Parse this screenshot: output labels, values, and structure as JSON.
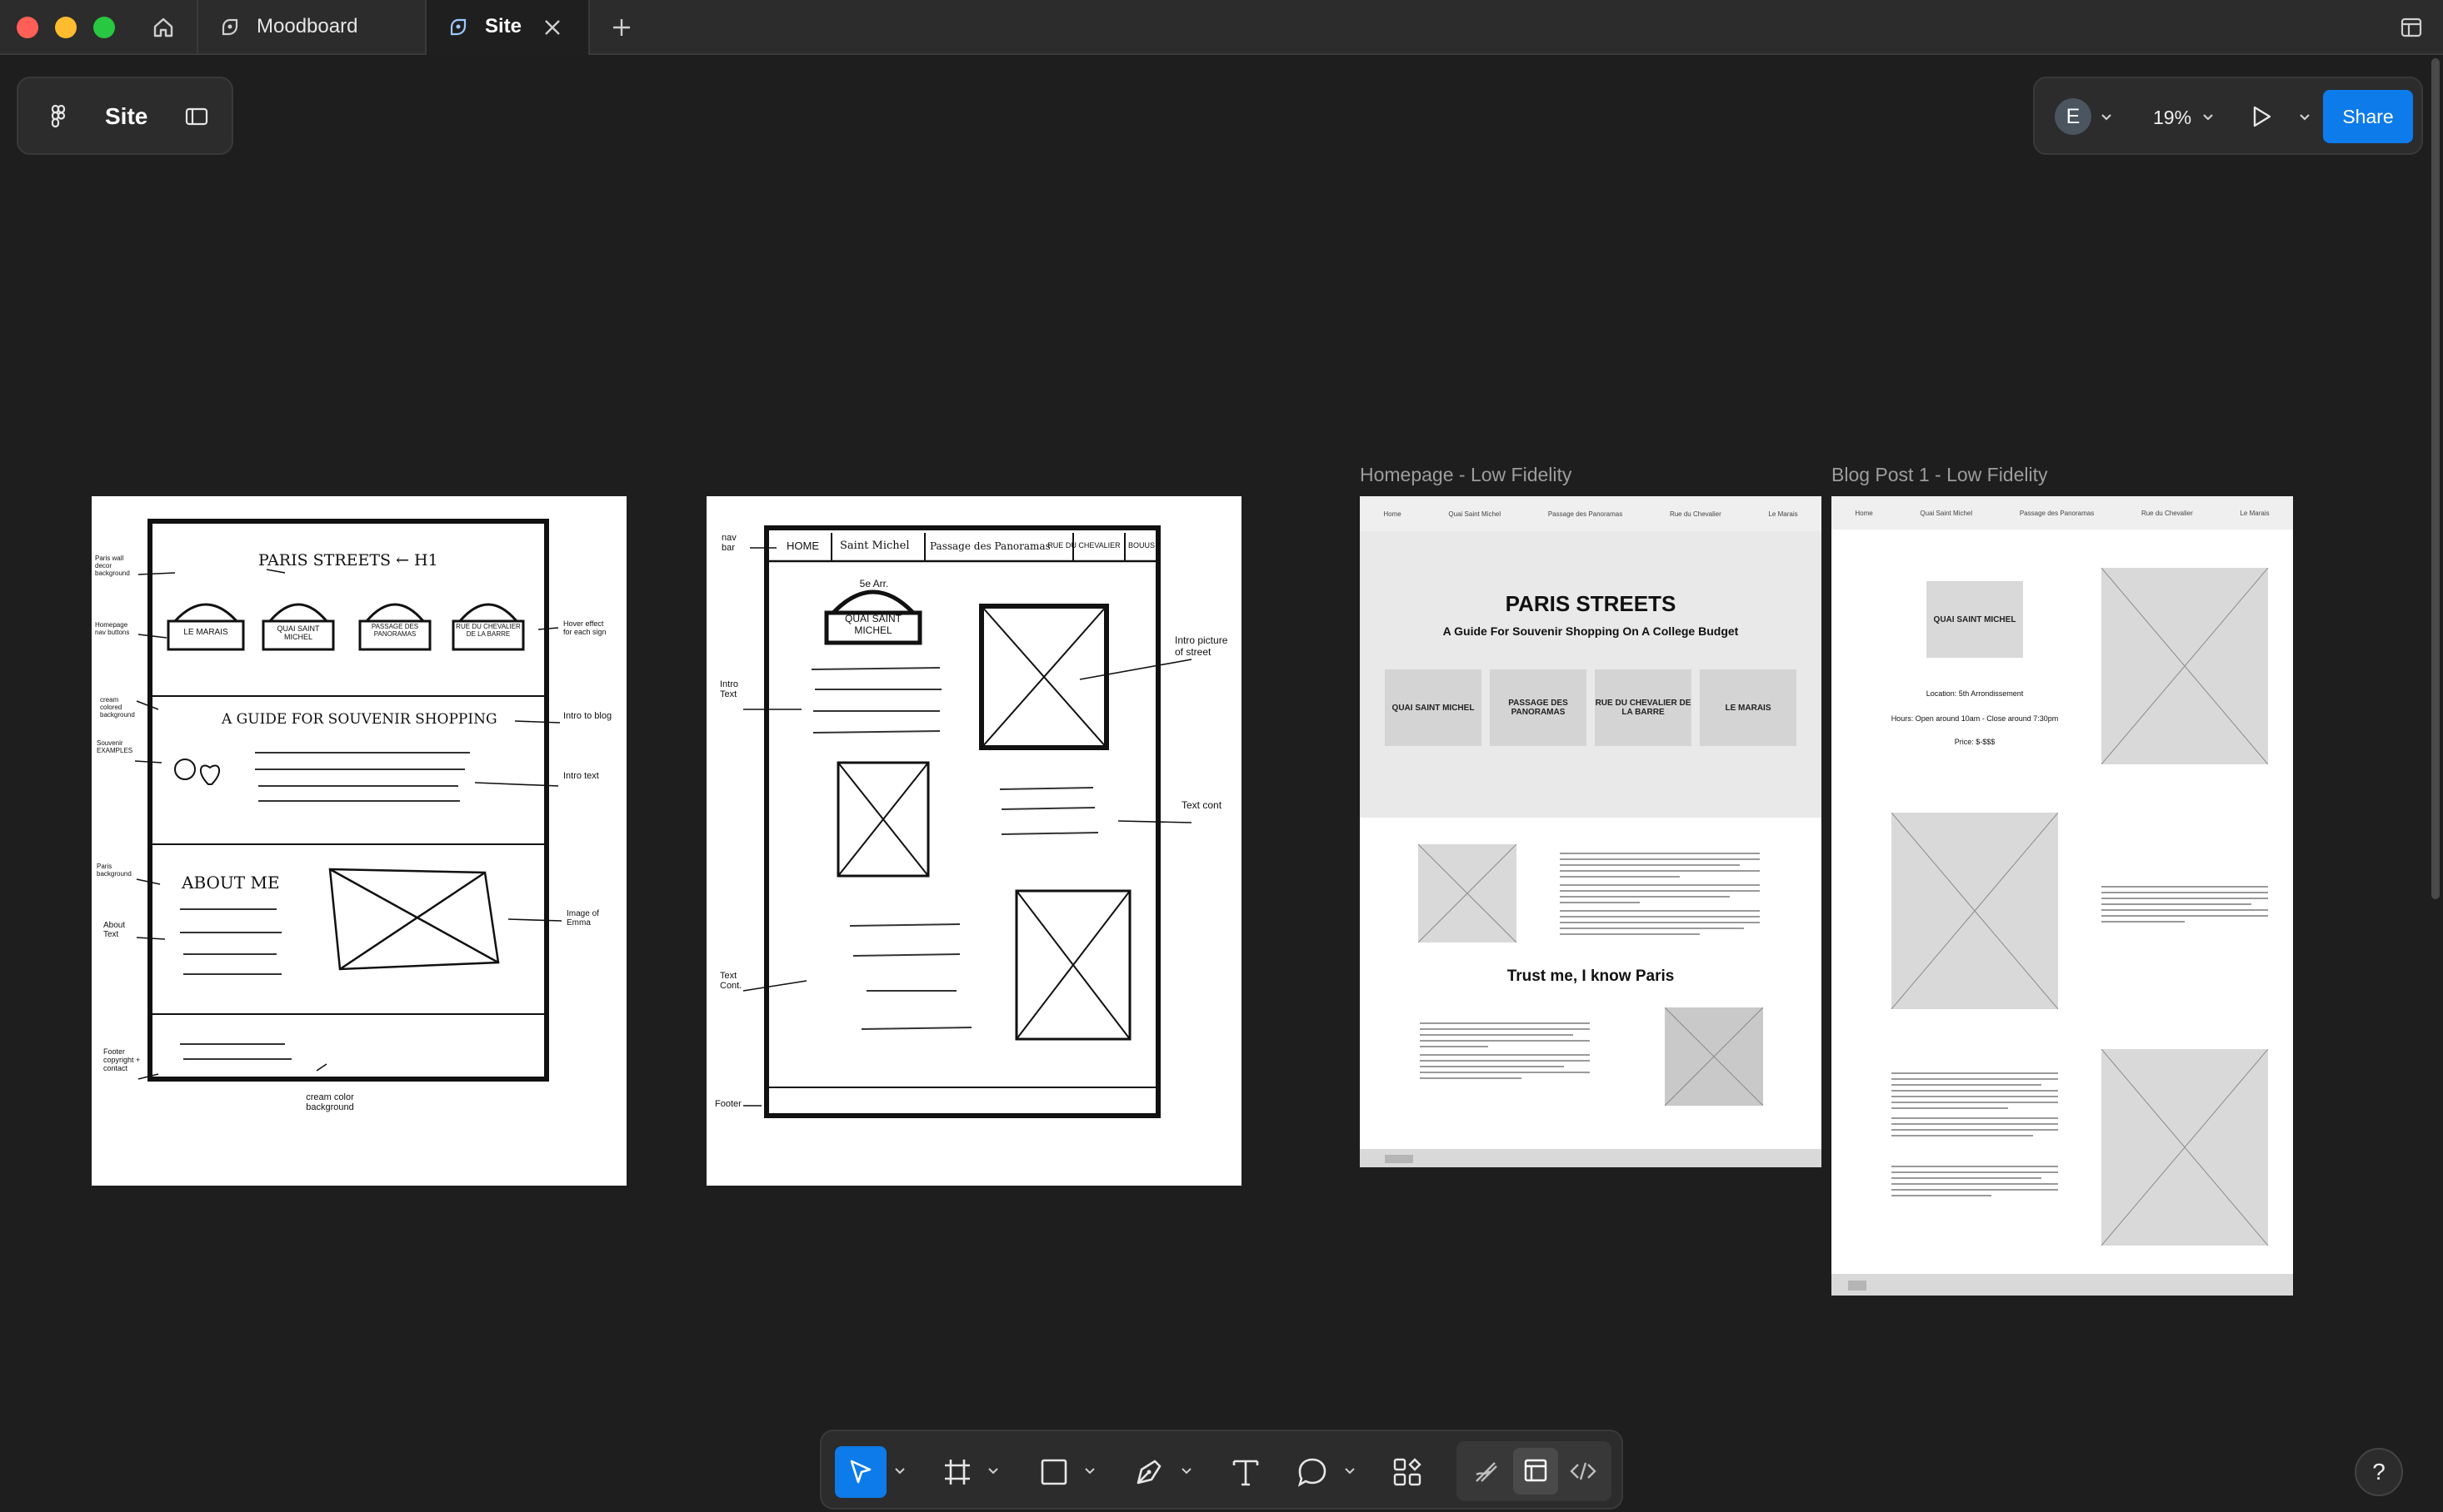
{
  "tabs": [
    {
      "label": "Moodboard",
      "active": false
    },
    {
      "label": "Site",
      "active": true
    }
  ],
  "file_panel": {
    "title": "Site"
  },
  "right_panel": {
    "avatar_initial": "E",
    "zoom": "19%",
    "share_label": "Share"
  },
  "frames": {
    "homepage_label": "Homepage - Low Fidelity",
    "blog_label": "Blog Post 1 - Low Fidelity"
  },
  "sketch1": {
    "title": "PARIS STREETS ← H1",
    "signs": [
      "LE MARAIS",
      "QUAI SAINT MICHEL",
      "PASSAGE DES PANORAMAS",
      "RUE DU CHEVALIER DE LA BARRE"
    ],
    "guide": "A GUIDE FOR SOUVENIR SHOPPING",
    "about": "ABOUT ME",
    "notes": {
      "paris_wall": "Paris wall decor background",
      "homepage_nav": "Homepage nav buttons",
      "cream": "cream colored background",
      "souvenir": "Souvenir EXAMPLES",
      "paris_bg": "Paris background",
      "about_text": "About Text",
      "footer": "Footer copyright + contact",
      "cream_bg": "cream color background",
      "hover": "Hover effect for each sign",
      "intro_blog": "Intro to blog",
      "intro_text": "Intro text",
      "image_emma": "Image of Emma"
    }
  },
  "sketch2": {
    "nav": [
      "HOME",
      "Saint Michel",
      "Passage des Panoramas",
      "RUE DU CHEVALIER",
      "BOUUS"
    ],
    "sign_top": "5e Arr.",
    "sign": "QUAI SAINT MICHEL",
    "notes": {
      "nav_bar": "nav bar",
      "intro_text": "Intro Text",
      "text_cont": "Text Cont.",
      "footer": "Footer",
      "intro_picture": "Intro picture of street",
      "text_cont_r": "Text cont"
    }
  },
  "homepage": {
    "nav": [
      "Home",
      "Quai Saint Michel",
      "Passage des Panoramas",
      "Rue du Chevalier",
      "Le Marais"
    ],
    "title": "PARIS STREETS",
    "subtitle": "A Guide For Souvenir Shopping On A College Budget",
    "buttons": [
      "QUAI SAINT MICHEL",
      "PASSAGE DES PANORAMAS",
      "RUE DU CHEVALIER DE LA BARRE",
      "LE MARAIS"
    ],
    "intro_heading": "Trust me, I know Paris"
  },
  "blog": {
    "nav": [
      "Home",
      "Quai Saint Michel",
      "Passage des Panoramas",
      "Rue du Chevalier",
      "Le Marais"
    ],
    "sign": "QUAI SAINT MICHEL",
    "location": "Location: 5th Arrondissement",
    "hours": "Hours: Open around 10am - Close around 7:30pm",
    "price": "Price: $-$$$"
  },
  "colors": {
    "accent": "#0d7bea",
    "canvas": "#1e1e1e",
    "panel": "#2c2c2c",
    "placeholder": "#d9d9d9"
  },
  "icons": [
    "home-icon",
    "figma-file-icon",
    "close-icon",
    "plus-icon",
    "figma-logo-icon",
    "sidebar-toggle-icon",
    "play-icon",
    "move-tool-icon",
    "frame-tool-icon",
    "rectangle-tool-icon",
    "pen-tool-icon",
    "text-tool-icon",
    "comment-tool-icon",
    "resources-icon",
    "draw-mode-icon",
    "design-mode-icon",
    "dev-mode-icon",
    "help-icon",
    "layout-icon"
  ]
}
